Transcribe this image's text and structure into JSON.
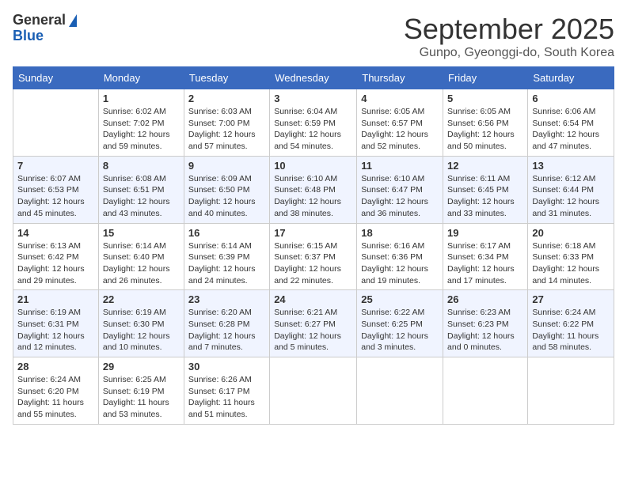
{
  "header": {
    "logo_general": "General",
    "logo_blue": "Blue",
    "month_title": "September 2025",
    "location": "Gunpo, Gyeonggi-do, South Korea"
  },
  "weekdays": [
    "Sunday",
    "Monday",
    "Tuesday",
    "Wednesday",
    "Thursday",
    "Friday",
    "Saturday"
  ],
  "weeks": [
    [
      {
        "day": "",
        "info": ""
      },
      {
        "day": "1",
        "info": "Sunrise: 6:02 AM\nSunset: 7:02 PM\nDaylight: 12 hours\nand 59 minutes."
      },
      {
        "day": "2",
        "info": "Sunrise: 6:03 AM\nSunset: 7:00 PM\nDaylight: 12 hours\nand 57 minutes."
      },
      {
        "day": "3",
        "info": "Sunrise: 6:04 AM\nSunset: 6:59 PM\nDaylight: 12 hours\nand 54 minutes."
      },
      {
        "day": "4",
        "info": "Sunrise: 6:05 AM\nSunset: 6:57 PM\nDaylight: 12 hours\nand 52 minutes."
      },
      {
        "day": "5",
        "info": "Sunrise: 6:05 AM\nSunset: 6:56 PM\nDaylight: 12 hours\nand 50 minutes."
      },
      {
        "day": "6",
        "info": "Sunrise: 6:06 AM\nSunset: 6:54 PM\nDaylight: 12 hours\nand 47 minutes."
      }
    ],
    [
      {
        "day": "7",
        "info": "Sunrise: 6:07 AM\nSunset: 6:53 PM\nDaylight: 12 hours\nand 45 minutes."
      },
      {
        "day": "8",
        "info": "Sunrise: 6:08 AM\nSunset: 6:51 PM\nDaylight: 12 hours\nand 43 minutes."
      },
      {
        "day": "9",
        "info": "Sunrise: 6:09 AM\nSunset: 6:50 PM\nDaylight: 12 hours\nand 40 minutes."
      },
      {
        "day": "10",
        "info": "Sunrise: 6:10 AM\nSunset: 6:48 PM\nDaylight: 12 hours\nand 38 minutes."
      },
      {
        "day": "11",
        "info": "Sunrise: 6:10 AM\nSunset: 6:47 PM\nDaylight: 12 hours\nand 36 minutes."
      },
      {
        "day": "12",
        "info": "Sunrise: 6:11 AM\nSunset: 6:45 PM\nDaylight: 12 hours\nand 33 minutes."
      },
      {
        "day": "13",
        "info": "Sunrise: 6:12 AM\nSunset: 6:44 PM\nDaylight: 12 hours\nand 31 minutes."
      }
    ],
    [
      {
        "day": "14",
        "info": "Sunrise: 6:13 AM\nSunset: 6:42 PM\nDaylight: 12 hours\nand 29 minutes."
      },
      {
        "day": "15",
        "info": "Sunrise: 6:14 AM\nSunset: 6:40 PM\nDaylight: 12 hours\nand 26 minutes."
      },
      {
        "day": "16",
        "info": "Sunrise: 6:14 AM\nSunset: 6:39 PM\nDaylight: 12 hours\nand 24 minutes."
      },
      {
        "day": "17",
        "info": "Sunrise: 6:15 AM\nSunset: 6:37 PM\nDaylight: 12 hours\nand 22 minutes."
      },
      {
        "day": "18",
        "info": "Sunrise: 6:16 AM\nSunset: 6:36 PM\nDaylight: 12 hours\nand 19 minutes."
      },
      {
        "day": "19",
        "info": "Sunrise: 6:17 AM\nSunset: 6:34 PM\nDaylight: 12 hours\nand 17 minutes."
      },
      {
        "day": "20",
        "info": "Sunrise: 6:18 AM\nSunset: 6:33 PM\nDaylight: 12 hours\nand 14 minutes."
      }
    ],
    [
      {
        "day": "21",
        "info": "Sunrise: 6:19 AM\nSunset: 6:31 PM\nDaylight: 12 hours\nand 12 minutes."
      },
      {
        "day": "22",
        "info": "Sunrise: 6:19 AM\nSunset: 6:30 PM\nDaylight: 12 hours\nand 10 minutes."
      },
      {
        "day": "23",
        "info": "Sunrise: 6:20 AM\nSunset: 6:28 PM\nDaylight: 12 hours\nand 7 minutes."
      },
      {
        "day": "24",
        "info": "Sunrise: 6:21 AM\nSunset: 6:27 PM\nDaylight: 12 hours\nand 5 minutes."
      },
      {
        "day": "25",
        "info": "Sunrise: 6:22 AM\nSunset: 6:25 PM\nDaylight: 12 hours\nand 3 minutes."
      },
      {
        "day": "26",
        "info": "Sunrise: 6:23 AM\nSunset: 6:23 PM\nDaylight: 12 hours\nand 0 minutes."
      },
      {
        "day": "27",
        "info": "Sunrise: 6:24 AM\nSunset: 6:22 PM\nDaylight: 11 hours\nand 58 minutes."
      }
    ],
    [
      {
        "day": "28",
        "info": "Sunrise: 6:24 AM\nSunset: 6:20 PM\nDaylight: 11 hours\nand 55 minutes."
      },
      {
        "day": "29",
        "info": "Sunrise: 6:25 AM\nSunset: 6:19 PM\nDaylight: 11 hours\nand 53 minutes."
      },
      {
        "day": "30",
        "info": "Sunrise: 6:26 AM\nSunset: 6:17 PM\nDaylight: 11 hours\nand 51 minutes."
      },
      {
        "day": "",
        "info": ""
      },
      {
        "day": "",
        "info": ""
      },
      {
        "day": "",
        "info": ""
      },
      {
        "day": "",
        "info": ""
      }
    ]
  ]
}
